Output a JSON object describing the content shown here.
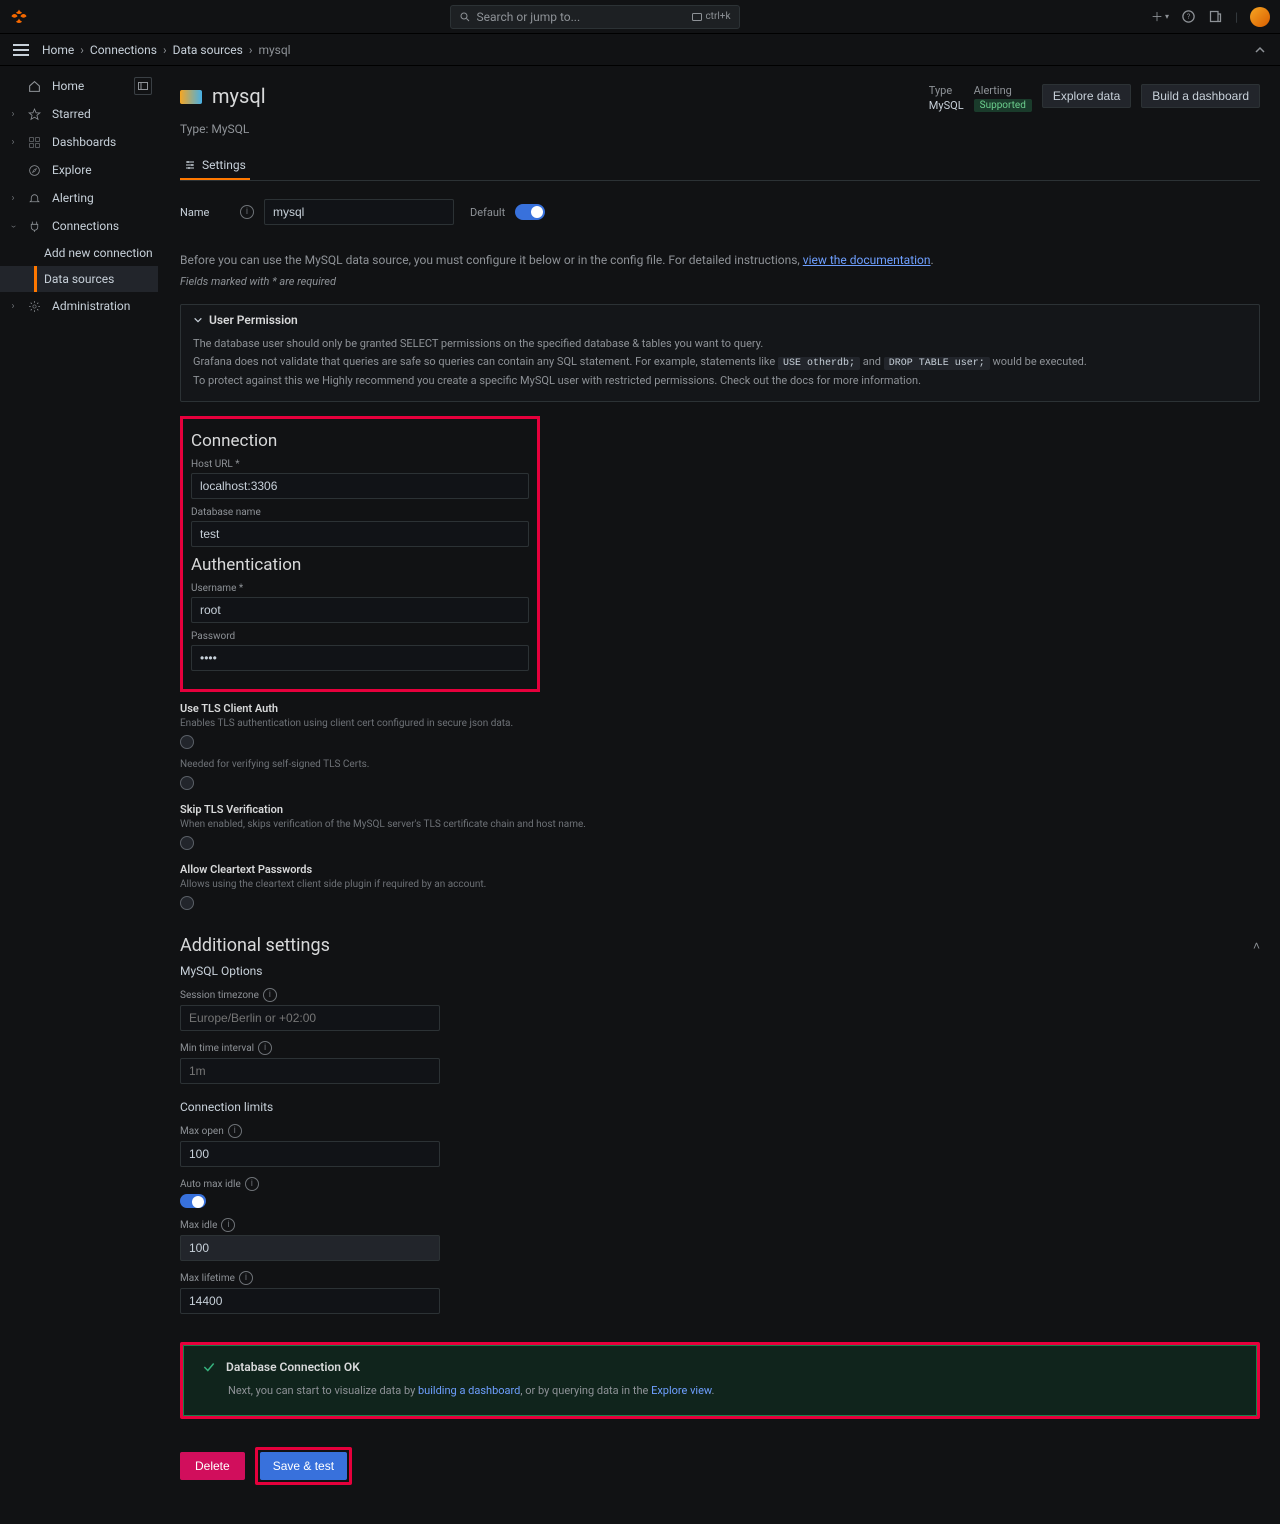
{
  "top": {
    "search_placeholder": "Search or jump to...",
    "kbd": "ctrl+k"
  },
  "breadcrumbs": {
    "home": "Home",
    "connections": "Connections",
    "datasources": "Data sources",
    "current": "mysql"
  },
  "sidebar": {
    "home": "Home",
    "starred": "Starred",
    "dashboards": "Dashboards",
    "explore": "Explore",
    "alerting": "Alerting",
    "connections": "Connections",
    "add_new": "Add new connection",
    "data_sources": "Data sources",
    "administration": "Administration"
  },
  "header": {
    "title": "mysql",
    "type_line": "Type: MySQL",
    "meta_type_lbl": "Type",
    "meta_type_val": "MySQL",
    "meta_alert_lbl": "Alerting",
    "meta_alert_val": "Supported",
    "explore_btn": "Explore data",
    "build_btn": "Build a dashboard"
  },
  "tabs": {
    "settings": "Settings"
  },
  "name_field": {
    "label": "Name",
    "value": "mysql",
    "default_label": "Default"
  },
  "intro": {
    "pre": "Before you can use the MySQL data source, you must configure it below or in the config file. For detailed instructions, ",
    "link": "view the documentation",
    "req": "Fields marked with * are required"
  },
  "permission": {
    "title": "User Permission",
    "l1": "The database user should only be granted SELECT permissions on the specified database & tables you want to query.",
    "l2a": "Grafana does not validate that queries are safe so queries can contain any SQL statement. For example, statements like ",
    "code1": "USE otherdb;",
    "l2b": " and ",
    "code2": "DROP TABLE user;",
    "l2c": " would be executed.",
    "l3": "To protect against this we Highly recommend you create a specific MySQL user with restricted permissions. Check out the docs for more information."
  },
  "connection": {
    "title": "Connection",
    "host_lbl": "Host URL *",
    "host_val": "localhost:3306",
    "db_lbl": "Database name",
    "db_val": "test"
  },
  "auth": {
    "title": "Authentication",
    "user_lbl": "Username *",
    "user_val": "root",
    "pass_lbl": "Password",
    "pass_val": "••••"
  },
  "tls_opts": {
    "client_auth_title": "Use TLS Client Auth",
    "client_auth_desc": "Enables TLS authentication using client cert configured in secure json data.",
    "ca_desc": "Needed for verifying self-signed TLS Certs.",
    "skip_title": "Skip TLS Verification",
    "skip_desc": "When enabled, skips verification of the MySQL server's TLS certificate chain and host name.",
    "cleartext_title": "Allow Cleartext Passwords",
    "cleartext_desc": "Allows using the cleartext client side plugin if required by an account."
  },
  "additional": {
    "title": "Additional settings",
    "mysql_opts": "MySQL Options",
    "tz_lbl": "Session timezone",
    "tz_ph": "Europe/Berlin or +02:00",
    "min_lbl": "Min time interval",
    "min_ph": "1m",
    "conn_limits": "Connection limits",
    "max_open_lbl": "Max open",
    "max_open_val": "100",
    "auto_idle_lbl": "Auto max idle",
    "max_idle_lbl": "Max idle",
    "max_idle_val": "100",
    "max_life_lbl": "Max lifetime",
    "max_life_val": "14400"
  },
  "success": {
    "title": "Database Connection OK",
    "pre": "Next, you can start to visualize data by ",
    "link1": "building a dashboard",
    "mid": ", or by querying data in the ",
    "link2": "Explore view",
    "post": "."
  },
  "actions": {
    "delete": "Delete",
    "save": "Save & test"
  }
}
